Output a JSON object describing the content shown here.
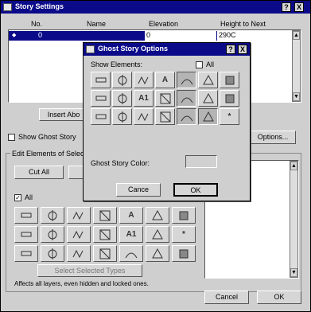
{
  "main_window": {
    "title": "Story Settings",
    "columns": [
      "No.",
      "Name",
      "Elevation",
      "Height to Next"
    ],
    "row": {
      "no": "0",
      "elevation": "0",
      "height": "290C"
    },
    "insert_above_label": "Insert Abo",
    "show_ghost_label": "Show Ghost Story",
    "options_label": "Options...",
    "edit_group_label": "Edit Elements of Selec",
    "cut_all_label": "Cut All",
    "all_label": "All",
    "all_checked": true,
    "select_button_label": "Select Selected Types",
    "footer_note": "Affects all layers, even hidden and locked ones.",
    "cancel_label": "Cancel",
    "ok_label": "OK",
    "help_label": "?",
    "close_label": "X"
  },
  "ghost_dialog": {
    "title": "Ghost Story Options",
    "show_elements_label": "Show Elements:",
    "all_label": "All",
    "all_checked": false,
    "ghost_color_label": "Ghost Story Color:",
    "cancel_label": "Cance",
    "ok_label": "OK",
    "help_label": "?",
    "close_label": "X",
    "elements": [
      {
        "name": "wall-tool-icon",
        "glyph": "",
        "selected": false
      },
      {
        "name": "column-tool-icon",
        "glyph": "",
        "selected": false
      },
      {
        "name": "beam-tool-icon",
        "glyph": "",
        "selected": false
      },
      {
        "name": "text-tool-icon",
        "glyph": "A",
        "selected": false
      },
      {
        "name": "line-tool-icon",
        "glyph": "",
        "selected": true
      },
      {
        "name": "picture-tool-icon",
        "glyph": "",
        "selected": false
      },
      {
        "name": "object-tool-icon",
        "glyph": "",
        "selected": false
      },
      {
        "name": "slab-tool-icon",
        "glyph": "",
        "selected": false
      },
      {
        "name": "dimension-tool-icon",
        "glyph": "",
        "selected": false
      },
      {
        "name": "label-tool-icon",
        "glyph": "A1",
        "selected": false
      },
      {
        "name": "polyline-tool-icon",
        "glyph": "",
        "selected": false
      },
      {
        "name": "window-tool-icon",
        "glyph": "",
        "selected": true
      },
      {
        "name": "roof-tool-icon",
        "glyph": "",
        "selected": false
      },
      {
        "name": "mesh-tool-icon",
        "glyph": "",
        "selected": false
      },
      {
        "name": "level-dimension-icon",
        "glyph": "",
        "selected": false
      },
      {
        "name": "camera-tool-icon",
        "glyph": "",
        "selected": false
      },
      {
        "name": "spline-tool-icon",
        "glyph": "",
        "selected": false
      },
      {
        "name": "stair-tool-icon",
        "glyph": "",
        "selected": false
      },
      {
        "name": "radial-dimension-icon",
        "glyph": "",
        "selected": true
      },
      {
        "name": "fill-tool-icon",
        "glyph": "",
        "selected": true
      },
      {
        "name": "hotspot-tool-icon",
        "glyph": "*",
        "selected": false
      }
    ]
  },
  "edit_elements": [
    {
      "name": "wall-tool-icon",
      "glyph": ""
    },
    {
      "name": "column-tool-icon",
      "glyph": ""
    },
    {
      "name": "beam-tool-icon",
      "glyph": ""
    },
    {
      "name": "dimension-tool-icon",
      "glyph": ""
    },
    {
      "name": "text-tool-icon",
      "glyph": "A"
    },
    {
      "name": "fill-tool-icon",
      "glyph": ""
    },
    {
      "name": "spline-tool-icon",
      "glyph": ""
    },
    {
      "name": "object-tool-icon",
      "glyph": ""
    },
    {
      "name": "lamp-tool-icon",
      "glyph": ""
    },
    {
      "name": "slab-tool-icon",
      "glyph": ""
    },
    {
      "name": "level-dimension-icon",
      "glyph": ""
    },
    {
      "name": "label-tool-icon",
      "glyph": "A1"
    },
    {
      "name": "line-tool-icon",
      "glyph": ""
    },
    {
      "name": "hotspot-tool-icon",
      "glyph": "*"
    },
    {
      "name": "roof-tool-icon",
      "glyph": ""
    },
    {
      "name": "door-tool-icon",
      "glyph": ""
    },
    {
      "name": "stair-tool-icon",
      "glyph": ""
    },
    {
      "name": "radial-dimension-icon",
      "glyph": ""
    },
    {
      "name": "zone-tool-icon",
      "glyph": ""
    },
    {
      "name": "polyline-tool-icon",
      "glyph": ""
    },
    {
      "name": "picture-tool-icon",
      "glyph": ""
    }
  ],
  "colors": {
    "title_bar": "#0b0b8a",
    "selection": "#0b0b8a",
    "face": "#d6d6d6"
  }
}
